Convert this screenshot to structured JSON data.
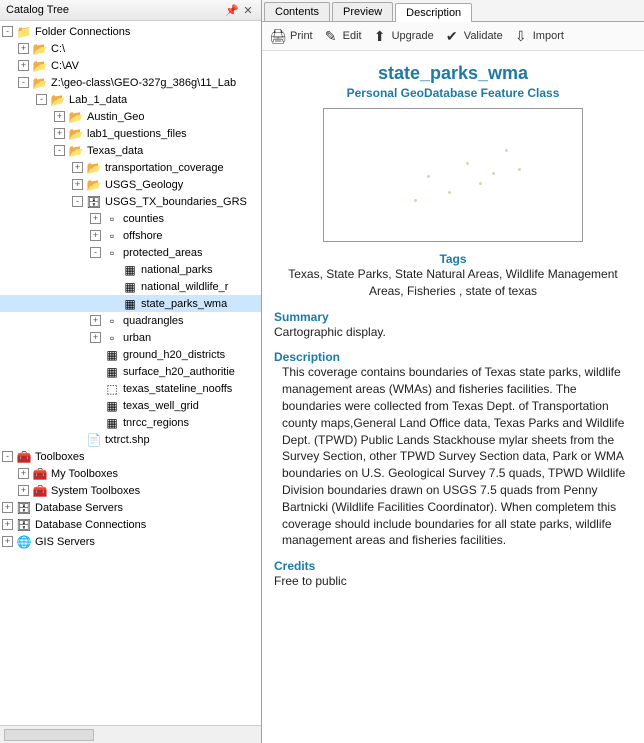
{
  "pane_title": "Catalog Tree",
  "tree": [
    {
      "d": 0,
      "t": "-",
      "i": "📁",
      "l": "Folder Connections"
    },
    {
      "d": 1,
      "t": "+",
      "i": "📂",
      "l": "C:\\"
    },
    {
      "d": 1,
      "t": "+",
      "i": "📂",
      "l": "C:\\AV"
    },
    {
      "d": 1,
      "t": "-",
      "i": "📂",
      "l": "Z:\\geo-class\\GEO-327g_386g\\11_Lab"
    },
    {
      "d": 2,
      "t": "-",
      "i": "📂",
      "l": "Lab_1_data"
    },
    {
      "d": 3,
      "t": "+",
      "i": "📂",
      "l": "Austin_Geo"
    },
    {
      "d": 3,
      "t": "+",
      "i": "📂",
      "l": "lab1_questions_files"
    },
    {
      "d": 3,
      "t": "-",
      "i": "📂",
      "l": "Texas_data"
    },
    {
      "d": 4,
      "t": "+",
      "i": "📂",
      "l": "transportation_coverage"
    },
    {
      "d": 4,
      "t": "+",
      "i": "📂",
      "l": "USGS_Geology"
    },
    {
      "d": 4,
      "t": "-",
      "i": "🗄",
      "l": "USGS_TX_boundaries_GRS"
    },
    {
      "d": 5,
      "t": "+",
      "i": "▫",
      "l": "counties"
    },
    {
      "d": 5,
      "t": "+",
      "i": "▫",
      "l": "offshore"
    },
    {
      "d": 5,
      "t": "-",
      "i": "▫",
      "l": "protected_areas"
    },
    {
      "d": 6,
      "t": " ",
      "i": "▦",
      "l": "national_parks"
    },
    {
      "d": 6,
      "t": " ",
      "i": "▦",
      "l": "national_wildlife_r"
    },
    {
      "d": 6,
      "t": " ",
      "i": "▦",
      "l": "state_parks_wma",
      "sel": true
    },
    {
      "d": 5,
      "t": "+",
      "i": "▫",
      "l": "quadrangles"
    },
    {
      "d": 5,
      "t": "+",
      "i": "▫",
      "l": "urban"
    },
    {
      "d": 5,
      "t": " ",
      "i": "▦",
      "l": "ground_h20_districts"
    },
    {
      "d": 5,
      "t": " ",
      "i": "▦",
      "l": "surface_h20_authoritie"
    },
    {
      "d": 5,
      "t": " ",
      "i": "⬚",
      "l": "texas_stateline_nooffs"
    },
    {
      "d": 5,
      "t": " ",
      "i": "▦",
      "l": "texas_well_grid"
    },
    {
      "d": 5,
      "t": " ",
      "i": "▦",
      "l": "tnrcc_regions"
    },
    {
      "d": 4,
      "t": " ",
      "i": "📄",
      "l": "txtrct.shp"
    },
    {
      "d": 0,
      "t": "-",
      "i": "🧰",
      "l": "Toolboxes"
    },
    {
      "d": 1,
      "t": "+",
      "i": "🧰",
      "l": "My Toolboxes"
    },
    {
      "d": 1,
      "t": "+",
      "i": "🧰",
      "l": "System Toolboxes"
    },
    {
      "d": 0,
      "t": "+",
      "i": "🗄",
      "l": "Database Servers"
    },
    {
      "d": 0,
      "t": "+",
      "i": "🗄",
      "l": "Database Connections"
    },
    {
      "d": 0,
      "t": "+",
      "i": "🌐",
      "l": "GIS Servers"
    }
  ],
  "tabs": {
    "contents": "Contents",
    "preview": "Preview",
    "description": "Description"
  },
  "toolbar": {
    "print": "Print",
    "edit": "Edit",
    "upgrade": "Upgrade",
    "validate": "Validate",
    "import": "Import"
  },
  "desc": {
    "title": "state_parks_wma",
    "subtitle": "Personal GeoDatabase Feature Class",
    "tags_label": "Tags",
    "tags": "Texas, State Parks, State Natural Areas, Wildlife Management Areas, Fisheries , state of texas",
    "summary_label": "Summary",
    "summary": "Cartographic display.",
    "description_label": "Description",
    "description": "This coverage contains boundaries of Texas state parks, wildlife management areas (WMAs) and fisheries facilities. The boundaries were collected from Texas Dept. of Transportation county maps,General Land Office data, Texas Parks and Wildlife Dept. (TPWD) Public Lands Stackhouse mylar sheets from the Survey Section, other TPWD Survey Section data, Park or WMA boundaries on U.S. Geological Survey 7.5 quads, TPWD Wildlife Division boundaries drawn on USGS 7.5 quads from Penny Bartnicki (Wildlife Facilities Coordinator). When completem this coverage should include boundaries for all state parks, wildlife management areas and fisheries facilities.",
    "credits_label": "Credits",
    "credits": "Free to public"
  }
}
